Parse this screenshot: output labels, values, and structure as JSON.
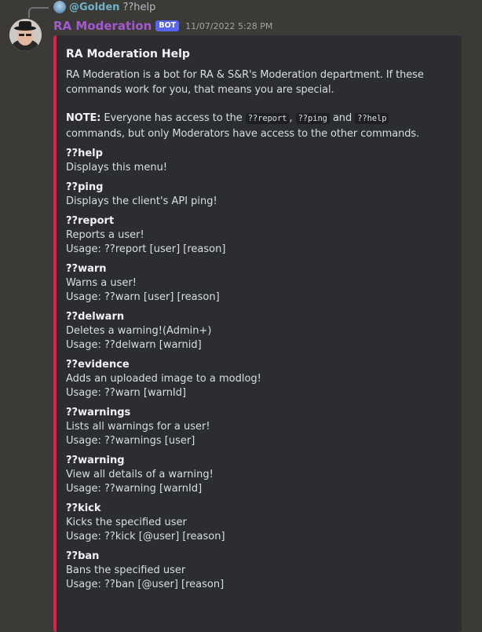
{
  "reply": {
    "user": "@Golden",
    "text": "??help"
  },
  "message": {
    "author": "RA Moderation",
    "bot_tag": "BOT",
    "timestamp": "11/07/2022 5:28 PM"
  },
  "embed": {
    "accent_color": "#e0204a",
    "title": "RA Moderation Help",
    "description": "RA Moderation is a bot for RA & S&R's Moderation department. If these commands work for you, that means you are special.",
    "note": {
      "label": "NOTE:",
      "text1": " Everyone has access to the ",
      "code1": "??report",
      "sep1": ", ",
      "code2": "??ping",
      "sep2": " and ",
      "code3": "??help",
      "text2": " commands, but only Moderators have access to the other commands."
    },
    "fields": [
      {
        "name": "??help",
        "lines": [
          "Displays this menu!"
        ]
      },
      {
        "name": "??ping",
        "lines": [
          "Displays the client's API ping!"
        ]
      },
      {
        "name": "??report",
        "lines": [
          "Reports a user!",
          "Usage: ??report [user] [reason]"
        ]
      },
      {
        "name": "??warn",
        "lines": [
          "Warns a user!",
          "Usage: ??warn [user] [reason]"
        ]
      },
      {
        "name": "??delwarn",
        "lines": [
          "Deletes a warning!(Admin+)",
          "Usage: ??delwarn [warnid]"
        ]
      },
      {
        "name": "??evidence",
        "lines": [
          "Adds an uploaded image to a modlog!",
          "Usage: ??warn [warnId]"
        ]
      },
      {
        "name": "??warnings",
        "lines": [
          "Lists all warnings for a user!",
          "Usage: ??warnings [user]"
        ]
      },
      {
        "name": "??warning",
        "lines": [
          "View all details of a warning!",
          "Usage: ??warning [warnId]"
        ]
      },
      {
        "name": "??kick",
        "lines": [
          "Kicks the specified user",
          "Usage: ??kick [@user] [reason]"
        ]
      },
      {
        "name": "??ban",
        "lines": [
          "Bans the specified user",
          "Usage: ??ban [@user] [reason]"
        ]
      }
    ]
  }
}
